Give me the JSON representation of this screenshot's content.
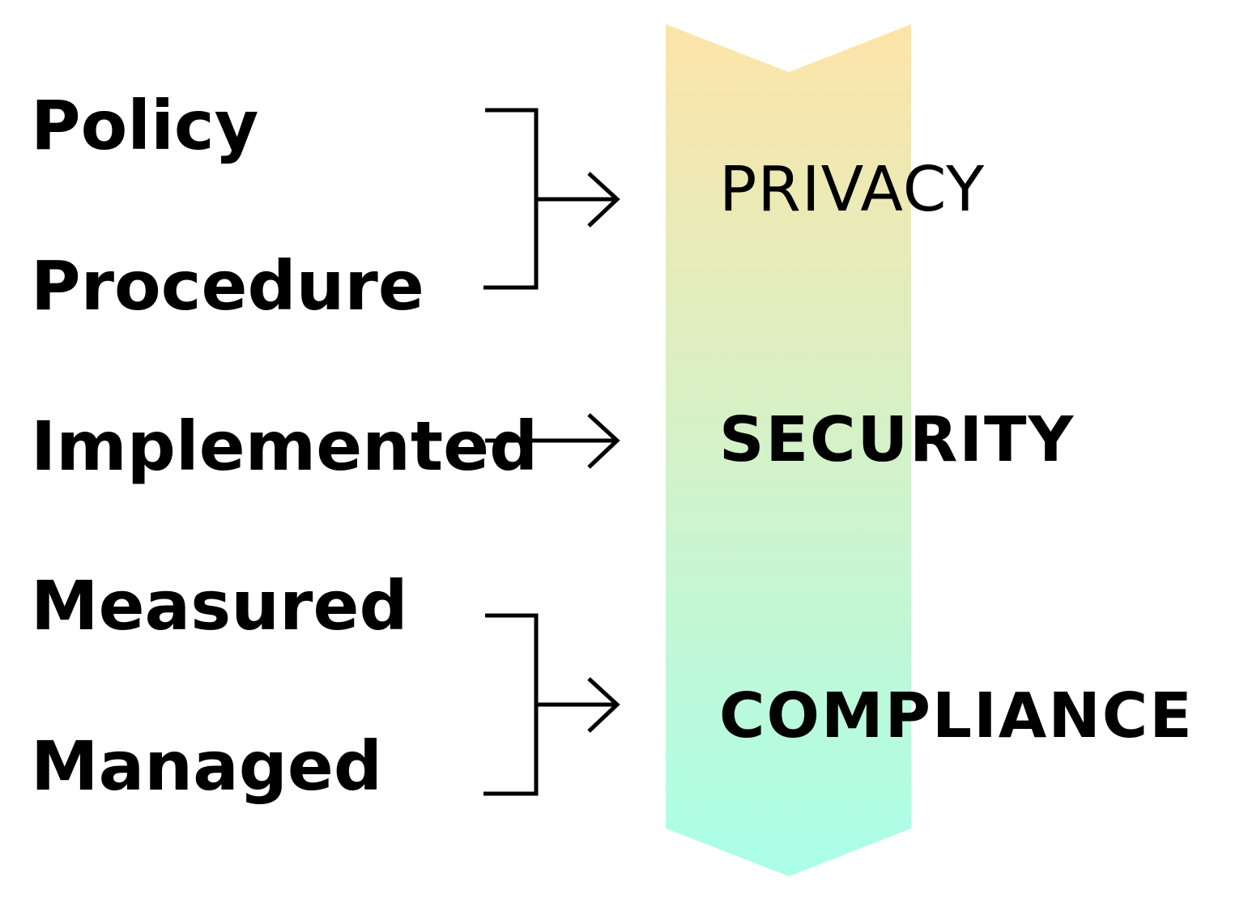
{
  "inputs": {
    "policy": "Policy",
    "procedure": "Procedure",
    "implemented": "Implemented",
    "measured": "Measured",
    "managed": "Managed"
  },
  "outcomes": {
    "privacy": "PRIVACY",
    "security": "SECURITY",
    "compliance": "COMPLIANCE"
  },
  "colors": {
    "banner_top": "#fde4a8",
    "banner_bottom": "#aaffe8",
    "stroke": "#000000"
  }
}
